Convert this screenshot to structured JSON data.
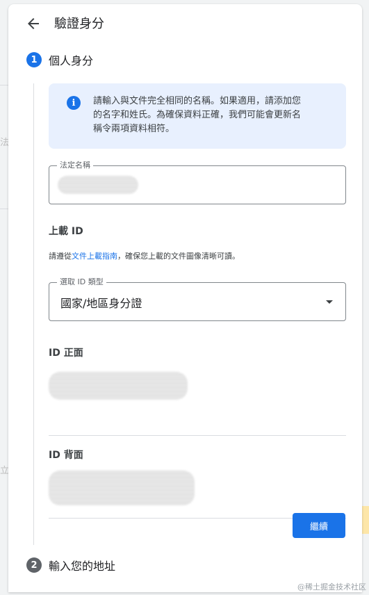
{
  "header": {
    "title": "驗證身分",
    "back_icon": "arrow-left-icon"
  },
  "steps": [
    {
      "number": "1",
      "title": "個人身分",
      "state": "active",
      "color": "#1a73e8"
    },
    {
      "number": "2",
      "title": "輸入您的地址",
      "state": "upcoming",
      "color": "#5f6368"
    }
  ],
  "info": {
    "icon": "info-icon",
    "lines": [
      "請輸入與文件完全相同的名稱。如果適用，請添加您",
      "的名字和姓氏。為確保資料正確，我們可能會更新名",
      "稱令兩項資料相符。"
    ]
  },
  "legal_name": {
    "label": "法定名稱",
    "value": ""
  },
  "upload": {
    "heading": "上載 ID",
    "guide_prefix": "請遵從",
    "guide_link": "文件上載指南",
    "guide_suffix": "，確保您上載的文件圖像清晰可讀。"
  },
  "id_type": {
    "label": "選取 ID 類型",
    "value": "國家/地區身分證"
  },
  "id_front": {
    "heading": "ID 正面"
  },
  "id_back": {
    "heading": "ID 背面"
  },
  "continue_label": "繼續",
  "watermark": "@稀土掘金技术社区",
  "colors": {
    "accent": "#1a73e8",
    "info_bg": "#e8f0fe"
  }
}
